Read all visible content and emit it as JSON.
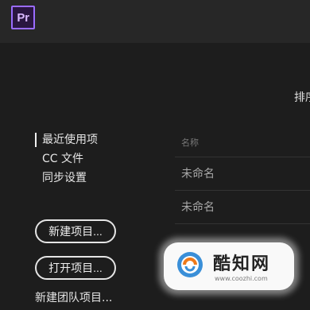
{
  "app": {
    "icon_text": "Pr",
    "accent_color": "#9a6cff"
  },
  "header": {
    "sort_label": "排序"
  },
  "sidebar": {
    "items": [
      {
        "label": "最近使用项",
        "active": true
      },
      {
        "label": "CC 文件",
        "active": false
      },
      {
        "label": "同步设置",
        "active": false
      }
    ],
    "new_project_button": "新建项目...",
    "open_project_button": "打开项目...",
    "new_team_project_link": "新建团队项目..."
  },
  "recent": {
    "column_header": "名称",
    "projects": [
      {
        "name": "未命名"
      },
      {
        "name": "未命名"
      }
    ]
  },
  "watermark": {
    "name": "酷知网",
    "url": "www.coozhi.com"
  }
}
